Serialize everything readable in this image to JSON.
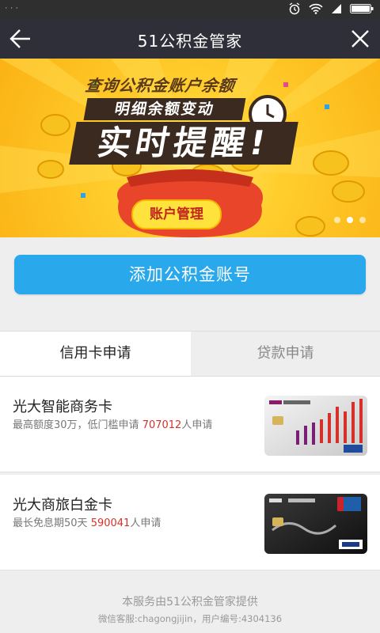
{
  "status_bar": {
    "left_text": "· · ·"
  },
  "nav": {
    "title": "51公积金管家"
  },
  "banner": {
    "line1": "查询公积金账户余额",
    "line2": "明细余额变动",
    "line3": "实时提醒!",
    "button": "账户管理"
  },
  "add_account_button": "添加公积金账号",
  "tabs": [
    {
      "label": "信用卡申请",
      "active": true
    },
    {
      "label": "贷款申请",
      "active": false
    }
  ],
  "cards": [
    {
      "name": "光大智能商务卡",
      "desc_prefix": "最高额度30万，低门槛申请 ",
      "count": "707012",
      "desc_suffix": "人申请"
    },
    {
      "name": "光大商旅白金卡",
      "desc_prefix": "最长免息期50天 ",
      "count": "590041",
      "desc_suffix": "人申请"
    }
  ],
  "footer": {
    "line1": "本服务由51公积金管家提供",
    "line2": "微信客服:chagongjijin，用户编号:4304136"
  },
  "colors": {
    "accent": "#29a9ec",
    "nav_bg": "#2f2f3a",
    "highlight": "#d6302a"
  }
}
